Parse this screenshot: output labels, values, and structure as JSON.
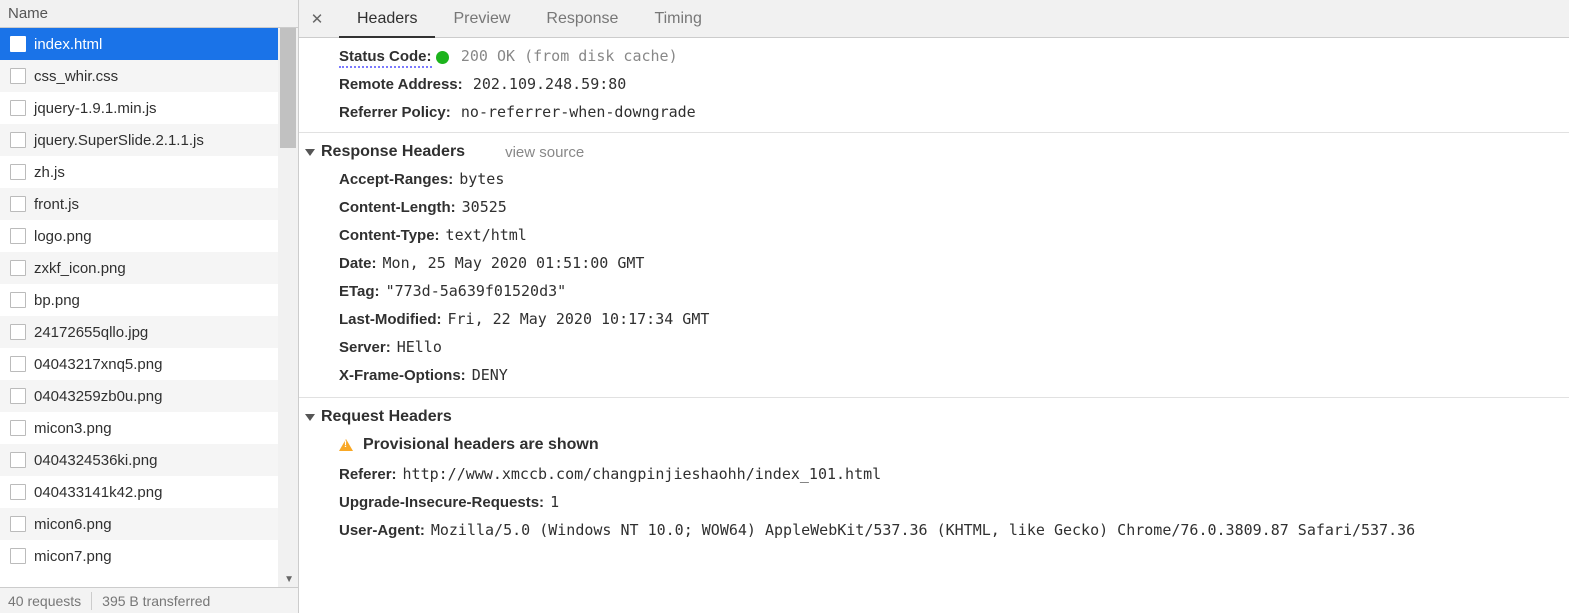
{
  "left": {
    "header": "Name",
    "files": [
      {
        "name": "index.html",
        "selected": true
      },
      {
        "name": "css_whir.css"
      },
      {
        "name": "jquery-1.9.1.min.js"
      },
      {
        "name": "jquery.SuperSlide.2.1.1.js"
      },
      {
        "name": "zh.js"
      },
      {
        "name": "front.js"
      },
      {
        "name": "logo.png"
      },
      {
        "name": "zxkf_icon.png"
      },
      {
        "name": "bp.png"
      },
      {
        "name": "24172655qllo.jpg"
      },
      {
        "name": "04043217xnq5.png"
      },
      {
        "name": "04043259zb0u.png"
      },
      {
        "name": "micon3.png"
      },
      {
        "name": "0404324536ki.png"
      },
      {
        "name": "040433141k42.png"
      },
      {
        "name": "micon6.png"
      },
      {
        "name": "micon7.png"
      }
    ],
    "status": {
      "requests": "40 requests",
      "transferred": "395 B transferred"
    }
  },
  "tabs": {
    "items": [
      "Headers",
      "Preview",
      "Response",
      "Timing"
    ],
    "active_index": 0
  },
  "general": {
    "status_code_label": "Status Code:",
    "status_code_value": "200 OK (from disk cache)",
    "remote_addr_label": "Remote Address:",
    "remote_addr_value": "202.109.248.59:80",
    "referrer_policy_label": "Referrer Policy:",
    "referrer_policy_value": "no-referrer-when-downgrade"
  },
  "response_headers": {
    "title": "Response Headers",
    "view_source": "view source",
    "items": [
      {
        "label": "Accept-Ranges:",
        "value": "bytes"
      },
      {
        "label": "Content-Length:",
        "value": "30525"
      },
      {
        "label": "Content-Type:",
        "value": "text/html"
      },
      {
        "label": "Date:",
        "value": "Mon, 25 May 2020 01:51:00 GMT"
      },
      {
        "label": "ETag:",
        "value": "\"773d-5a639f01520d3\""
      },
      {
        "label": "Last-Modified:",
        "value": "Fri, 22 May 2020 10:17:34 GMT"
      },
      {
        "label": "Server:",
        "value": "HEllo"
      },
      {
        "label": "X-Frame-Options:",
        "value": "DENY"
      }
    ]
  },
  "request_headers": {
    "title": "Request Headers",
    "warning": "Provisional headers are shown",
    "items": [
      {
        "label": "Referer:",
        "value": "http://www.xmccb.com/changpinjieshaohh/index_101.html"
      },
      {
        "label": "Upgrade-Insecure-Requests:",
        "value": "1"
      },
      {
        "label": "User-Agent:",
        "value": "Mozilla/5.0 (Windows NT 10.0; WOW64) AppleWebKit/537.36 (KHTML, like Gecko) Chrome/76.0.3809.87 Safari/537.36"
      }
    ]
  }
}
